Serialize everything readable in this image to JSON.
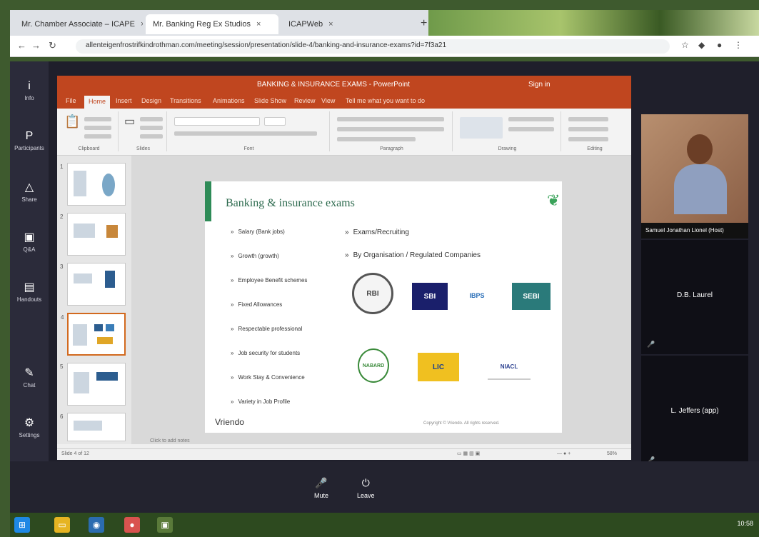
{
  "browser": {
    "tabs": [
      {
        "label": "Mr. Chamber Associate – ICAPE"
      },
      {
        "label": "Mr. Banking Reg Ex Studios"
      },
      {
        "label": "ICAPWeb"
      }
    ],
    "url": "allenteigenfrostrifkindrothman.com/meeting/session/presentation/slide-4/banking-and-insurance-exams?id=7f3a21"
  },
  "rail": {
    "items": [
      {
        "label": "Info",
        "icon": "i"
      },
      {
        "label": "Participants",
        "icon": "P"
      },
      {
        "label": "Share",
        "icon": "△"
      },
      {
        "label": "Q&A",
        "icon": "▣"
      },
      {
        "label": "Handouts",
        "icon": "▤"
      },
      {
        "label": "Chat",
        "icon": "✎"
      },
      {
        "label": "Settings",
        "icon": "⚙"
      }
    ]
  },
  "ppt": {
    "window_title": "BANKING & INSURANCE EXAMS - PowerPoint",
    "user": "Sign in",
    "tabs": [
      "File",
      "Home",
      "Insert",
      "Design",
      "Transitions",
      "Animations",
      "Slide Show",
      "Review",
      "View",
      "Tell me what you want to do"
    ],
    "ribbon_groups": [
      "Clipboard",
      "Slides",
      "Font",
      "Paragraph",
      "Drawing",
      "Editing"
    ],
    "notes": "Click to add notes",
    "status": "Slide 4 of 12",
    "zoom": "58%"
  },
  "slide": {
    "title": "Banking & insurance exams",
    "left_bullets": [
      "Salary (Bank jobs)",
      "Growth (growth)",
      "Employee Benefit schemes",
      "Fixed Allowances",
      "Respectable professional",
      "Job security for students",
      "Work Stay & Convenience",
      "Variety in Job Profile"
    ],
    "right_bullets": [
      "Exams/Recruiting",
      "By Organisation / Regulated Companies"
    ],
    "logos": [
      "RBI",
      "SBI",
      "IBPS",
      "SEBI",
      "NABARD",
      "LIC",
      "NIACL"
    ],
    "brand": "Vriendo",
    "footer": "Copyright © Vriendo. All rights reserved."
  },
  "participants": {
    "presenter_name": "Samuel Jonathan Lionel (Host)",
    "tiles": [
      {
        "name": "D.B. Laurel"
      },
      {
        "name": "L. Jeffers (app)"
      }
    ]
  },
  "controls": {
    "items": [
      {
        "label": "Mute",
        "icon": "🎤"
      },
      {
        "label": "Leave",
        "icon": "⏻"
      }
    ]
  },
  "taskbar": {
    "time": "10:58"
  },
  "colors": {
    "ppt_accent": "#c0461f",
    "slide_accent": "#2e8b57",
    "app_bg": "#1f1f2b"
  }
}
